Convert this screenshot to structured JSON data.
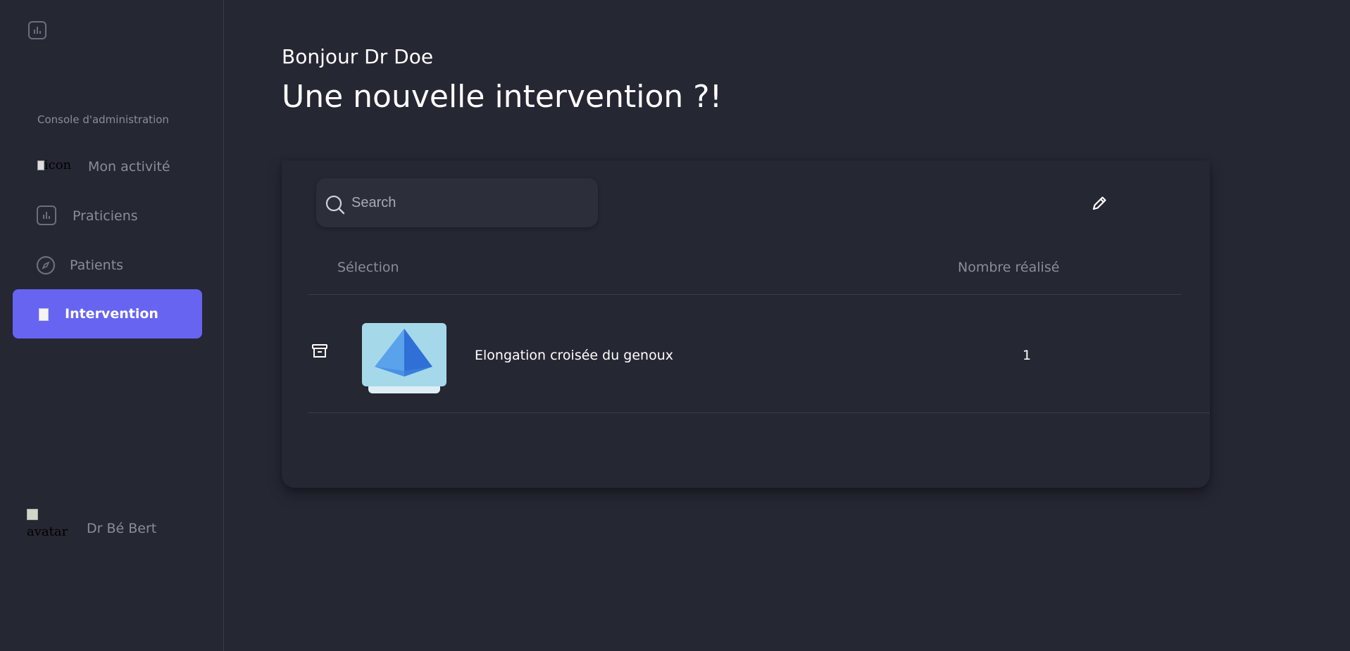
{
  "sidebar": {
    "console_label": "Console d'administration",
    "items": [
      {
        "label": "Mon activité",
        "icon": "broken-image-icon",
        "broken_alt": "icon"
      },
      {
        "label": "Praticiens",
        "icon": "bar-chart-icon"
      },
      {
        "label": "Patients",
        "icon": "compass-icon"
      },
      {
        "label": "Intervention",
        "icon": "broken-image-icon",
        "active": true
      }
    ],
    "user": {
      "avatar_alt": "avatar",
      "name": "Dr Bé Bert"
    }
  },
  "header": {
    "greeting": "Bonjour Dr Doe",
    "headline": "Une nouvelle intervention ?!"
  },
  "search": {
    "placeholder": "Search"
  },
  "table": {
    "columns": [
      "Sélection",
      "Nombre réalisé"
    ],
    "rows": [
      {
        "name": "Elongation croisée du genoux",
        "count": "1"
      }
    ]
  },
  "colors": {
    "accent": "#6764f2",
    "background": "#252733",
    "muted_text": "#8a8c98"
  }
}
